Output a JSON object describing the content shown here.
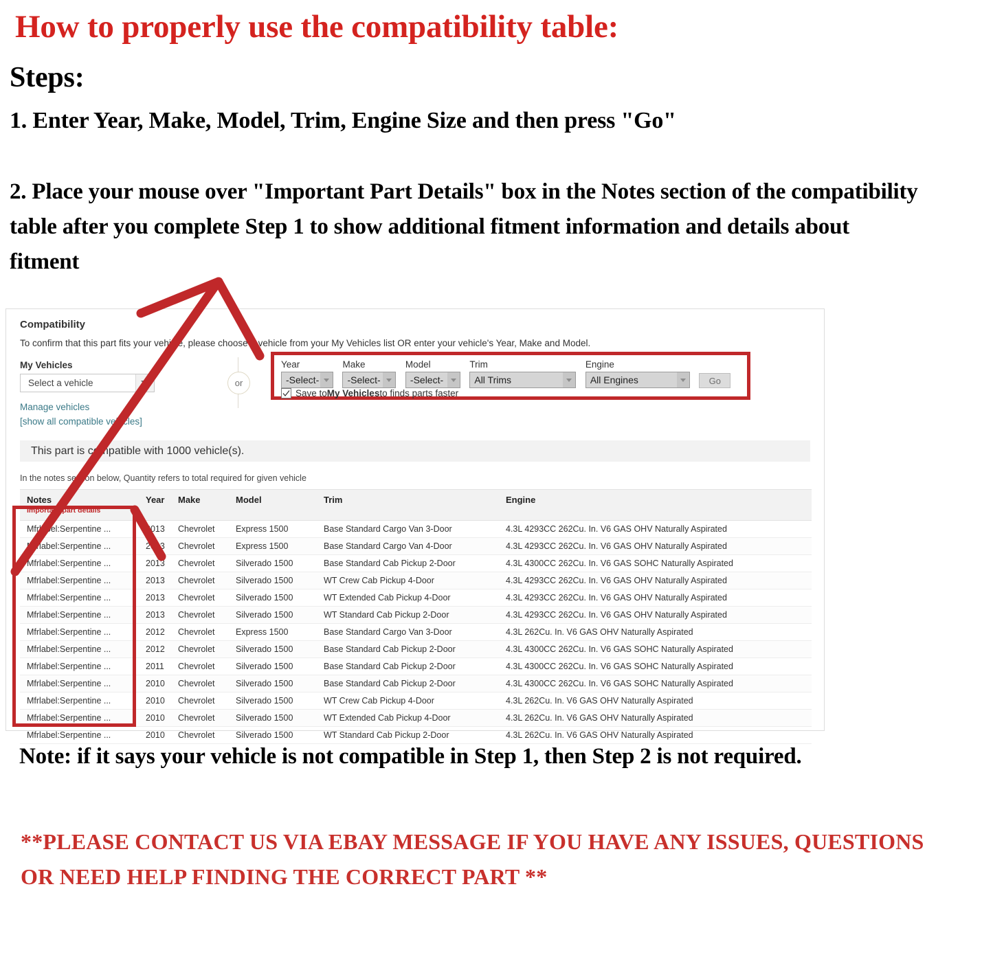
{
  "doc": {
    "title_main": "How to properly use the compatibility table:",
    "steps_label": "Steps:",
    "step_1": "1. Enter Year, Make, Model, Trim, Engine Size and then press \"Go\"",
    "step_2": "2. Place your mouse over \"Important Part Details\" box in the Notes section of the compatibility table after you complete Step 1 to show additional fitment information and details about fitment",
    "note": "Note: if it says your vehicle is not compatible in Step 1, then Step 2 is not required.",
    "contact": "**PLEASE CONTACT US VIA EBAY MESSAGE IF YOU HAVE ANY ISSUES, QUESTIONS OR NEED HELP FINDING THE CORRECT PART **"
  },
  "colors": {
    "headline_red": "#d4231f",
    "annotation_red": "#c0282a",
    "link_teal": "#3b7a88",
    "notes_header_red": "#c0282a"
  },
  "compat": {
    "heading": "Compatibility",
    "subtitle": "To confirm that this part fits your vehicle, please choose a vehicle from your My Vehicles list OR enter your vehicle's Year, Make and Model.",
    "my_vehicles_label": "My Vehicles",
    "my_vehicles_value": "Select a vehicle",
    "manage_vehicles_link": "Manage vehicles",
    "or_text": "or",
    "show_all_link": "[show all compatible vehicles]",
    "count_text": "This part is compatible with 1000 vehicle(s).",
    "quantity_note": "In the notes section below, Quantity refers to total required for given vehicle",
    "save_prefix": "Save to ",
    "save_bold": "My Vehicles",
    "save_suffix": " to finds parts faster",
    "go_label": "Go",
    "fields": [
      {
        "label": "Year",
        "value": "-Select-"
      },
      {
        "label": "Make",
        "value": "-Select-"
      },
      {
        "label": "Model",
        "value": "-Select-"
      },
      {
        "label": "Trim",
        "value": "All Trims"
      },
      {
        "label": "Engine",
        "value": "All Engines"
      }
    ]
  },
  "table": {
    "headers": {
      "notes": "Notes",
      "notes_sub": "Important part details",
      "year": "Year",
      "make": "Make",
      "model": "Model",
      "trim": "Trim",
      "engine": "Engine"
    },
    "rows": [
      {
        "notes": "Mfrlabel:Serpentine ...",
        "year": "2013",
        "make": "Chevrolet",
        "model": "Express 1500",
        "trim": "Base Standard Cargo Van 3-Door",
        "engine": "4.3L 4293CC 262Cu. In. V6 GAS OHV Naturally Aspirated"
      },
      {
        "notes": "Mfrlabel:Serpentine ...",
        "year": "2013",
        "make": "Chevrolet",
        "model": "Express 1500",
        "trim": "Base Standard Cargo Van 4-Door",
        "engine": "4.3L 4293CC 262Cu. In. V6 GAS OHV Naturally Aspirated"
      },
      {
        "notes": "Mfrlabel:Serpentine ...",
        "year": "2013",
        "make": "Chevrolet",
        "model": "Silverado 1500",
        "trim": "Base Standard Cab Pickup 2-Door",
        "engine": "4.3L 4300CC 262Cu. In. V6 GAS SOHC Naturally Aspirated"
      },
      {
        "notes": "Mfrlabel:Serpentine ...",
        "year": "2013",
        "make": "Chevrolet",
        "model": "Silverado 1500",
        "trim": "WT Crew Cab Pickup 4-Door",
        "engine": "4.3L 4293CC 262Cu. In. V6 GAS OHV Naturally Aspirated"
      },
      {
        "notes": "Mfrlabel:Serpentine ...",
        "year": "2013",
        "make": "Chevrolet",
        "model": "Silverado 1500",
        "trim": "WT Extended Cab Pickup 4-Door",
        "engine": "4.3L 4293CC 262Cu. In. V6 GAS OHV Naturally Aspirated"
      },
      {
        "notes": "Mfrlabel:Serpentine ...",
        "year": "2013",
        "make": "Chevrolet",
        "model": "Silverado 1500",
        "trim": "WT Standard Cab Pickup 2-Door",
        "engine": "4.3L 4293CC 262Cu. In. V6 GAS OHV Naturally Aspirated"
      },
      {
        "notes": "Mfrlabel:Serpentine ...",
        "year": "2012",
        "make": "Chevrolet",
        "model": "Express 1500",
        "trim": "Base Standard Cargo Van 3-Door",
        "engine": "4.3L 262Cu. In. V6 GAS OHV Naturally Aspirated"
      },
      {
        "notes": "Mfrlabel:Serpentine ...",
        "year": "2012",
        "make": "Chevrolet",
        "model": "Silverado 1500",
        "trim": "Base Standard Cab Pickup 2-Door",
        "engine": "4.3L 4300CC 262Cu. In. V6 GAS SOHC Naturally Aspirated"
      },
      {
        "notes": "Mfrlabel:Serpentine ...",
        "year": "2011",
        "make": "Chevrolet",
        "model": "Silverado 1500",
        "trim": "Base Standard Cab Pickup 2-Door",
        "engine": "4.3L 4300CC 262Cu. In. V6 GAS SOHC Naturally Aspirated"
      },
      {
        "notes": "Mfrlabel:Serpentine ...",
        "year": "2010",
        "make": "Chevrolet",
        "model": "Silverado 1500",
        "trim": "Base Standard Cab Pickup 2-Door",
        "engine": "4.3L 4300CC 262Cu. In. V6 GAS SOHC Naturally Aspirated"
      },
      {
        "notes": "Mfrlabel:Serpentine ...",
        "year": "2010",
        "make": "Chevrolet",
        "model": "Silverado 1500",
        "trim": "WT Crew Cab Pickup 4-Door",
        "engine": "4.3L 262Cu. In. V6 GAS OHV Naturally Aspirated"
      },
      {
        "notes": "Mfrlabel:Serpentine ...",
        "year": "2010",
        "make": "Chevrolet",
        "model": "Silverado 1500",
        "trim": "WT Extended Cab Pickup 4-Door",
        "engine": "4.3L 262Cu. In. V6 GAS OHV Naturally Aspirated"
      },
      {
        "notes": "Mfrlabel:Serpentine ...",
        "year": "2010",
        "make": "Chevrolet",
        "model": "Silverado 1500",
        "trim": "WT Standard Cab Pickup 2-Door",
        "engine": "4.3L 262Cu. In. V6 GAS OHV Naturally Aspirated"
      }
    ]
  }
}
